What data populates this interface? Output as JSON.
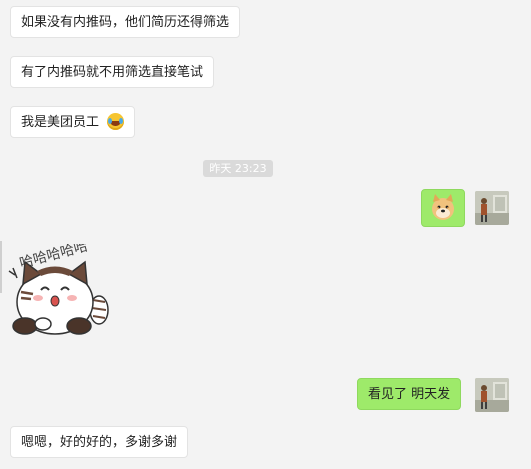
{
  "messages": [
    {
      "text": "如果没有内推码，他们简历还得筛选"
    },
    {
      "text": "有了内推码就不用筛选直接笔试"
    },
    {
      "text": "我是美团员工"
    },
    {
      "text": "看见了 明天发"
    },
    {
      "text": "嗯嗯，好的好的，多谢多谢"
    }
  ],
  "timestamp": "昨天 23:23",
  "icons": {
    "laugh_emoji": "laugh-cry-emoji-icon",
    "doge_sticker": "doge-sticker-icon",
    "cat_sticker": "cat-laughing-sticker-icon"
  },
  "cat_sticker_text": "哈哈哈哈哈",
  "colors": {
    "background": "#f3f3f3",
    "incoming_bubble": "#ffffff",
    "outgoing_bubble": "#9eea6a",
    "timestamp_bg": "#dadada"
  }
}
